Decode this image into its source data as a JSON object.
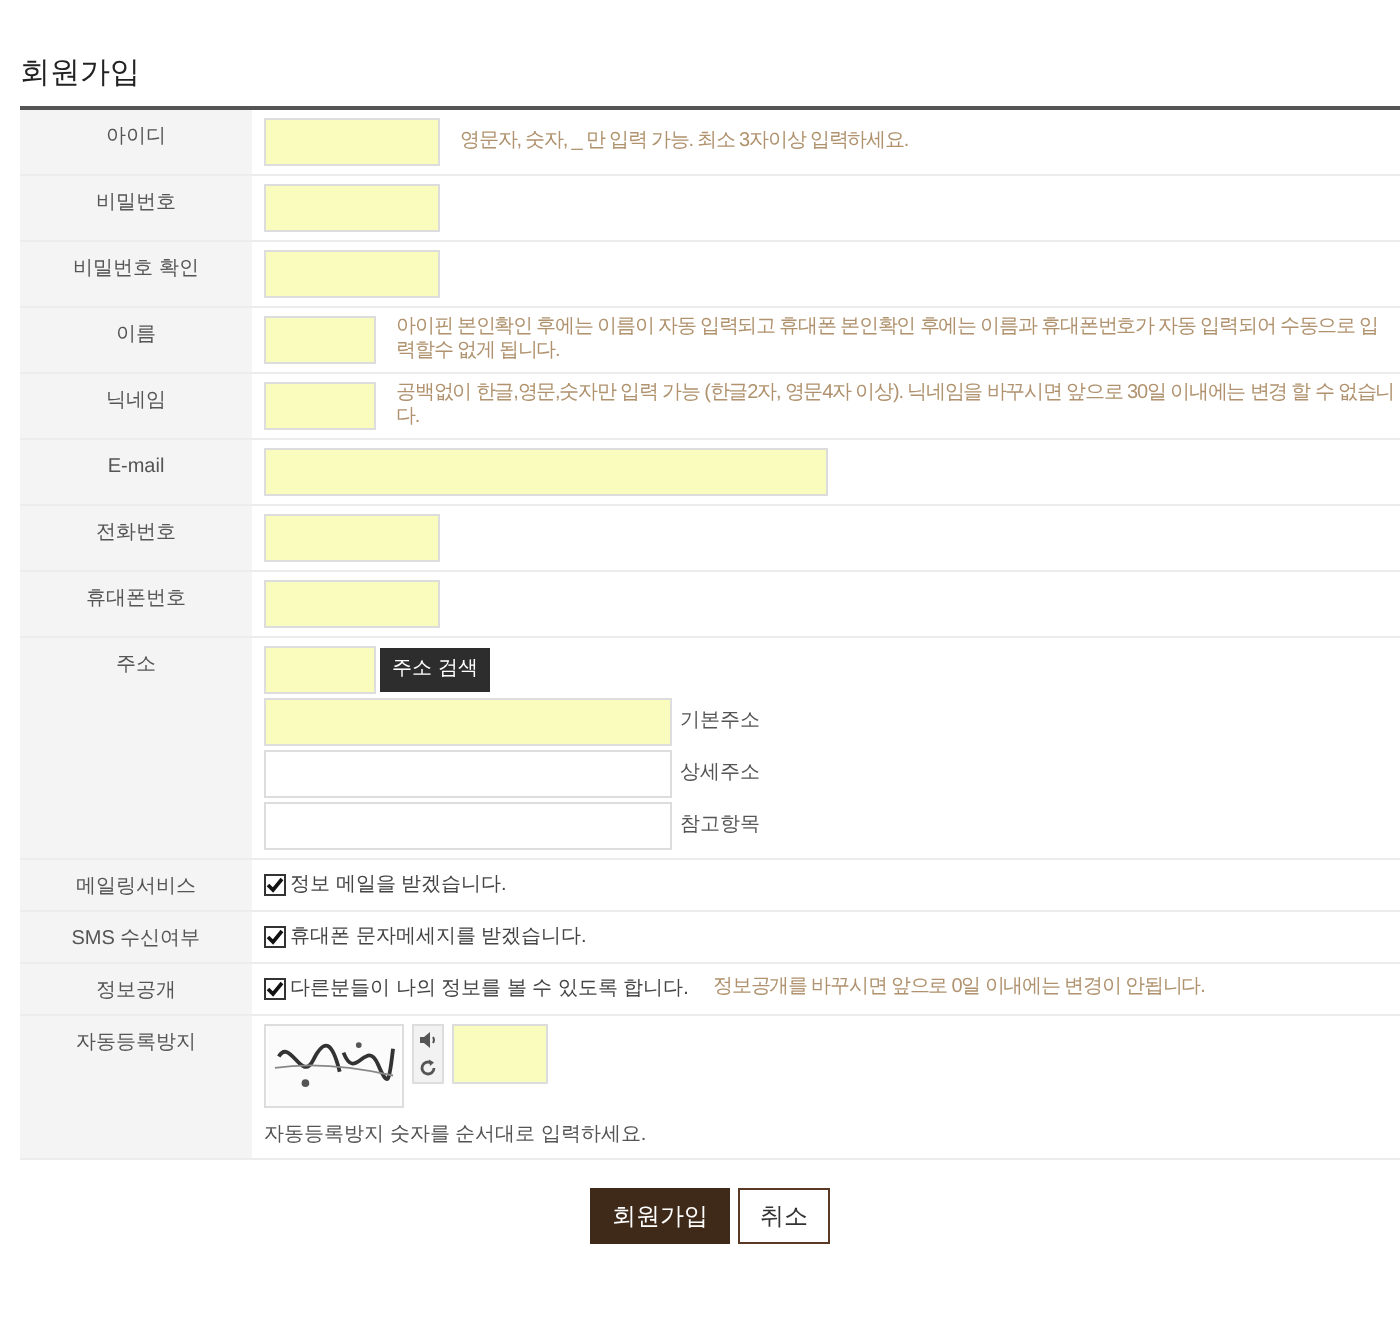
{
  "title": "회원가입",
  "rows": [
    {
      "label": "아이디",
      "kind": "field",
      "field": {
        "kind": "medium",
        "required": true
      },
      "hint": "영문자, 숫자, _ 만 입력 가능. 최소 3자이상 입력하세요."
    },
    {
      "label": "비밀번호",
      "kind": "field",
      "field": {
        "kind": "medium",
        "required": true
      }
    },
    {
      "label": "비밀번호 확인",
      "kind": "field",
      "field": {
        "kind": "medium",
        "required": true
      }
    },
    {
      "label": "이름",
      "kind": "field",
      "field": {
        "kind": "short",
        "required": true
      },
      "hint": "아이핀 본인확인 후에는 이름이 자동 입력되고 휴대폰 본인확인 후에는 이름과 휴대폰번호가 자동 입력되어 수동으로 입력할수 없게 됩니다."
    },
    {
      "label": "닉네임",
      "kind": "field",
      "field": {
        "kind": "short",
        "required": true
      },
      "hint": "공백없이 한글,영문,숫자만 입력 가능 (한글2자, 영문4자 이상). 닉네임을 바꾸시면 앞으로 30일 이내에는 변경 할 수 없습니다."
    },
    {
      "label": "E-mail",
      "kind": "field",
      "field": {
        "kind": "long",
        "required": true
      }
    },
    {
      "label": "전화번호",
      "kind": "field",
      "field": {
        "kind": "medium",
        "required": true
      }
    },
    {
      "label": "휴대폰번호",
      "kind": "field",
      "field": {
        "kind": "medium",
        "required": true
      }
    },
    {
      "label": "주소",
      "kind": "address",
      "zip": {
        "required": true
      },
      "button": "주소 검색",
      "lines": [
        {
          "label": "기본주소",
          "required": true
        },
        {
          "label": "상세주소",
          "required": false
        },
        {
          "label": "참고항목",
          "required": false
        }
      ]
    },
    {
      "label": "메일링서비스",
      "kind": "check",
      "checked": true,
      "text": "정보 메일을 받겠습니다."
    },
    {
      "label": "SMS 수신여부",
      "kind": "check",
      "checked": true,
      "text": "휴대폰 문자메세지를 받겠습니다."
    },
    {
      "label": "정보공개",
      "kind": "check",
      "checked": true,
      "text": "다른분들이 나의 정보를 볼 수 있도록 합니다.",
      "hint": "정보공개를 바꾸시면 앞으로 0일 이내에는 변경이 안됩니다."
    },
    {
      "label": "자동등록방지",
      "kind": "captcha",
      "field": {
        "required": true
      },
      "hint": "자동등록방지 숫자를 순서대로 입력하세요."
    }
  ],
  "buttons": [
    {
      "label": "회원가입",
      "kind": "primary"
    },
    {
      "label": "취소",
      "kind": "secondary"
    }
  ]
}
